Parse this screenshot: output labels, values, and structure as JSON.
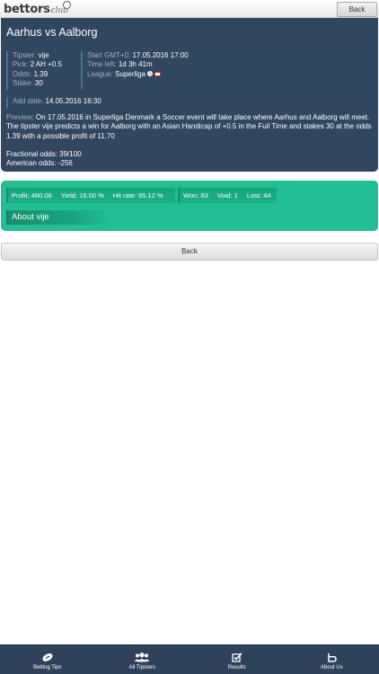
{
  "header": {
    "logo_main": "bettors",
    "logo_sub": "club",
    "back_label": "Back"
  },
  "match": {
    "title": "Aarhus vs Aalborg",
    "tipster_label": "Tipster:",
    "tipster": "vije",
    "pick_label": "Pick:",
    "pick": "2 AH +0.5",
    "odds_label": "Odds:",
    "odds": "1.39",
    "stake_label": "Stake:",
    "stake": "30",
    "start_label": "Start GMT+0:",
    "start": "17.05.2016 17:00",
    "time_left_label": "Time left:",
    "time_left": "1d 3h 41m",
    "league_label": "League:",
    "league": "Superliga",
    "add_date_label": "Add date:",
    "add_date": "14.05.2016 16:30",
    "preview_label": "Preview:",
    "preview": "On 17.05.2016 in Superliga Denmark a Soccer event will take place where Aarhus and Aalborg will meet. The tipster vije predicts a win for Aalborg with an Asian Handicap of +0.5 in the Full Time and stakes 30 at the odds 1.39 with a possible profit of 11.70",
    "fractional_label": "Fractional odds:",
    "fractional": "39/100",
    "american_label": "American odds:",
    "american": "-256"
  },
  "stats": {
    "profit": "Profit: 480.06",
    "yield": "Yield: 16.00 %",
    "hit_rate": "Hit rate: 65.12 %",
    "won": "Won: 83",
    "void": "Void: 1",
    "lost": "Lost: 44",
    "about": "About vije"
  },
  "back_bar_label": "Back",
  "tabs": [
    {
      "label": "Betting Tips",
      "icon": "football-icon"
    },
    {
      "label": "All Tipsters",
      "icon": "users-icon"
    },
    {
      "label": "Results",
      "icon": "checkbox-icon"
    },
    {
      "label": "About Us",
      "icon": "logo-b-icon"
    }
  ]
}
